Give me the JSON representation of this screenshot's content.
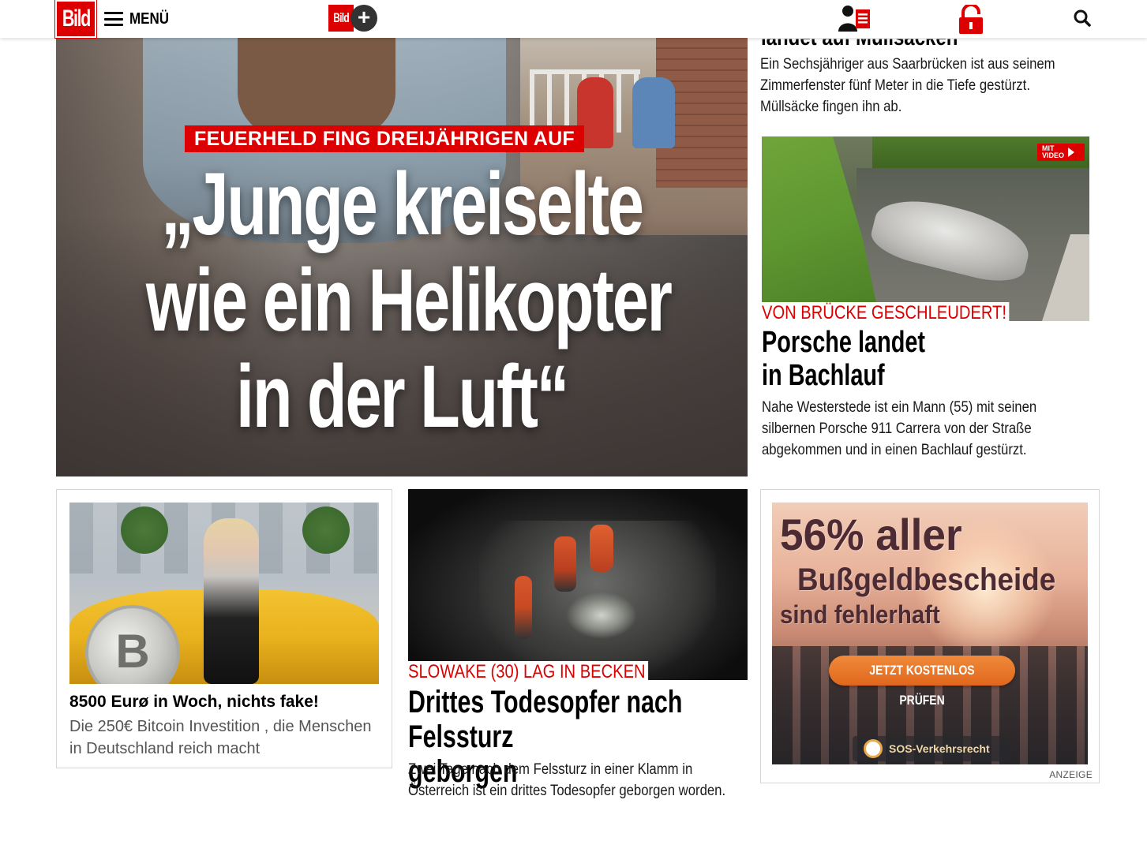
{
  "header": {
    "logo_text": "Bild",
    "menu_label": "MENÜ",
    "bildplus_logo_text": "Bild",
    "bildplus_plus": "+",
    "brand_color": "#dd0000"
  },
  "top_cut_teaser": {
    "headline_partial": "landet auf Müllsäcken",
    "text": "Ein Sechsjähriger aus Saarbrücken ist aus seinem Zimmerfenster fünf Meter in die Tiefe gestürzt. Müllsäcke fingen ihn ab."
  },
  "hero": {
    "kicker": "FEUERHELD FING DREIJÄHRIGEN AUF",
    "headline_lines": [
      "„Junge kreiselte",
      "wie ein Helikopter",
      "in der Luft“"
    ]
  },
  "porsche": {
    "badge_line1": "MIT",
    "badge_line2": "VIDEO",
    "kicker": "VON BRÜCKE GESCHLEUDERT!",
    "headline_lines": [
      "Porsche landet",
      "in Bachlauf"
    ],
    "text": "Nahe Westerstede ist ein Mann (55) mit seinen silbernen Porsche 911 Carrera von der Straße abgekommen und in einen Bachlauf gestürzt."
  },
  "bitcoin_ad": {
    "coin_symbol": "B",
    "title": "8500 Eurø in Woch, nichts fake!",
    "subtitle": "Die 250€ Bitcoin Investition , die Menschen in Deutschland reich macht"
  },
  "felssturz": {
    "kicker": "SLOWAKE (30) LAG IN BECKEN",
    "headline_lines": [
      "Drittes Todesopfer nach Felssturz",
      "geborgen"
    ],
    "text": "Zwei Tage nach dem Felssturz in einer Klamm in Österreich ist ein drittes Todesopfer geborgen worden."
  },
  "bussgeld_ad": {
    "line1": "56% aller",
    "line2": "Bußgeldbescheide",
    "line3": "sind fehlerhaft",
    "cta": "JETZT KOSTENLOS PRÜFEN",
    "brand": "SOS-Verkehrsrecht",
    "label": "ANZEIGE"
  }
}
